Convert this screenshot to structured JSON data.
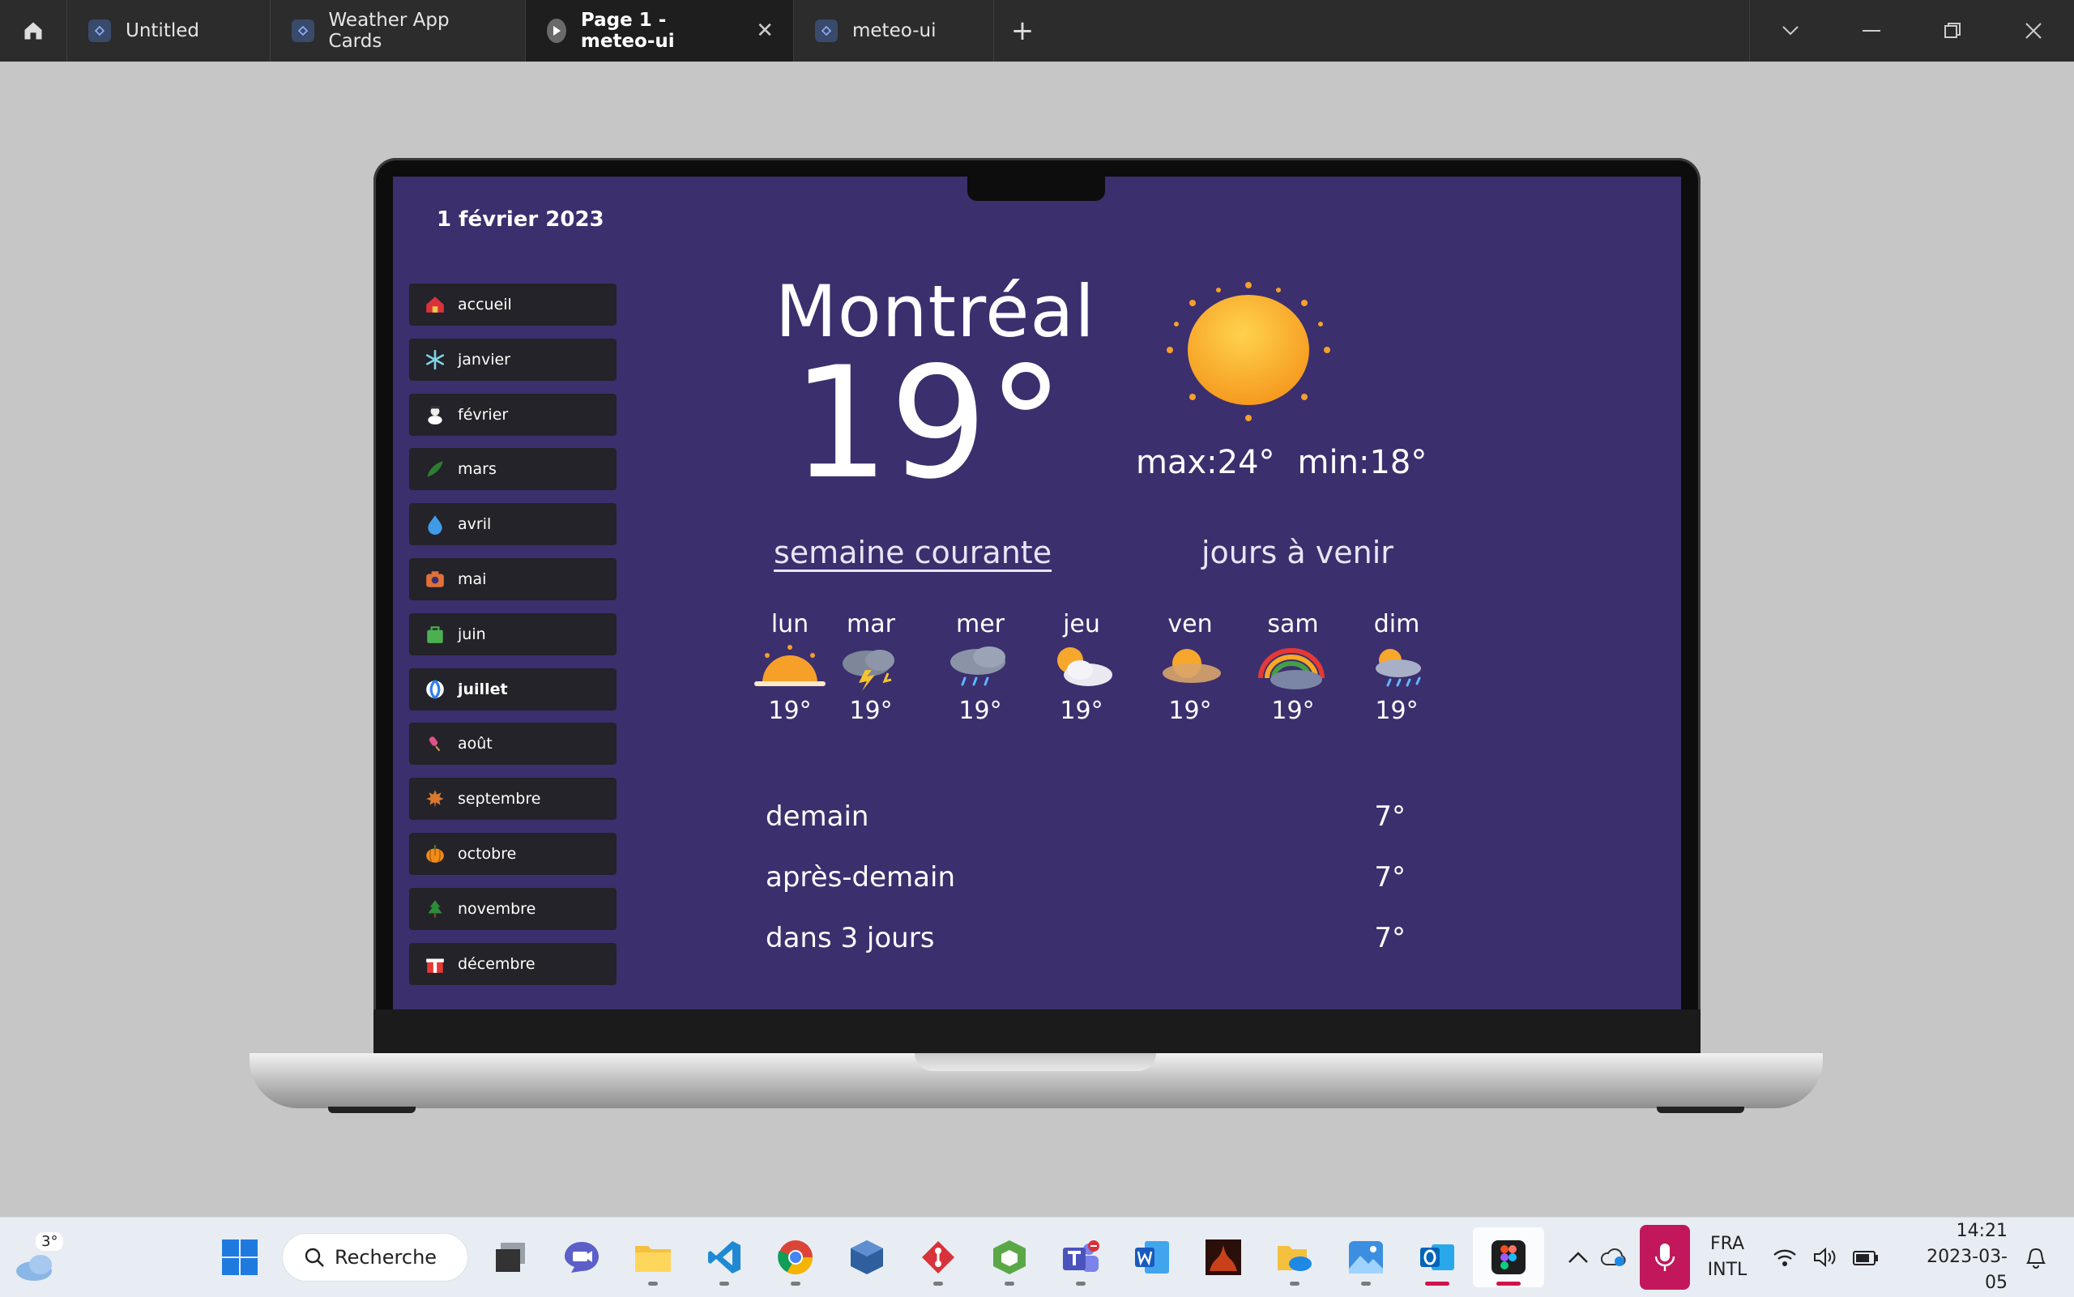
{
  "tabs": [
    {
      "label": "Untitled",
      "icon": "figma-file-icon"
    },
    {
      "label": "Weather App Cards",
      "icon": "figma-file-icon"
    },
    {
      "label": "Page 1 - meteo-ui",
      "icon": "play-icon",
      "active": true
    },
    {
      "label": "meteo-ui",
      "icon": "figma-file-icon"
    }
  ],
  "app": {
    "date": "1 février 2023",
    "city": "Montréal",
    "temperature": "19°",
    "max": "max:24°",
    "min": "min:18°",
    "tab_week": "semaine courante",
    "tab_upcoming": "jours à venir"
  },
  "months": [
    {
      "label": "accueil",
      "icon": "house-icon"
    },
    {
      "label": "janvier",
      "icon": "snowflake-icon"
    },
    {
      "label": "février",
      "icon": "snowman-icon"
    },
    {
      "label": "mars",
      "icon": "leaves-icon"
    },
    {
      "label": "avril",
      "icon": "droplet-icon"
    },
    {
      "label": "mai",
      "icon": "camera-icon"
    },
    {
      "label": "juin",
      "icon": "bag-icon"
    },
    {
      "label": "juillet",
      "icon": "beach-ball-icon"
    },
    {
      "label": "août",
      "icon": "popsicle-icon"
    },
    {
      "label": "septembre",
      "icon": "maple-leaf-icon"
    },
    {
      "label": "octobre",
      "icon": "pumpkin-icon"
    },
    {
      "label": "novembre",
      "icon": "tree-icon"
    },
    {
      "label": "décembre",
      "icon": "gift-icon"
    }
  ],
  "week": [
    {
      "day": "lun",
      "temp": "19°",
      "icon": "sunrise-icon"
    },
    {
      "day": "mar",
      "temp": "19°",
      "icon": "thunderstorm-icon"
    },
    {
      "day": "mer",
      "temp": "19°",
      "icon": "rain-cloud-icon"
    },
    {
      "day": "jeu",
      "temp": "19°",
      "icon": "sun-cloud-icon"
    },
    {
      "day": "ven",
      "temp": "19°",
      "icon": "sun-cloud-icon"
    },
    {
      "day": "sam",
      "temp": "19°",
      "icon": "rainbow-icon"
    },
    {
      "day": "dim",
      "temp": "19°",
      "icon": "sun-rain-icon"
    }
  ],
  "forecast": [
    {
      "label": "demain",
      "temp": "7°"
    },
    {
      "label": "après-demain",
      "temp": "7°"
    },
    {
      "label": "dans 3 jours",
      "temp": "7°"
    }
  ],
  "taskbar": {
    "weather_temp": "3°",
    "search_label": "Recherche",
    "lang_1": "FRA",
    "lang_2": "INTL",
    "time": "14:21",
    "date": "2023-03-05"
  },
  "colors": {
    "screen_bg": "#3b2f6e",
    "sidebar_item_bg": "#232329",
    "tabbar_bg": "#2c2c2c",
    "accent_mic": "#c2185b"
  }
}
